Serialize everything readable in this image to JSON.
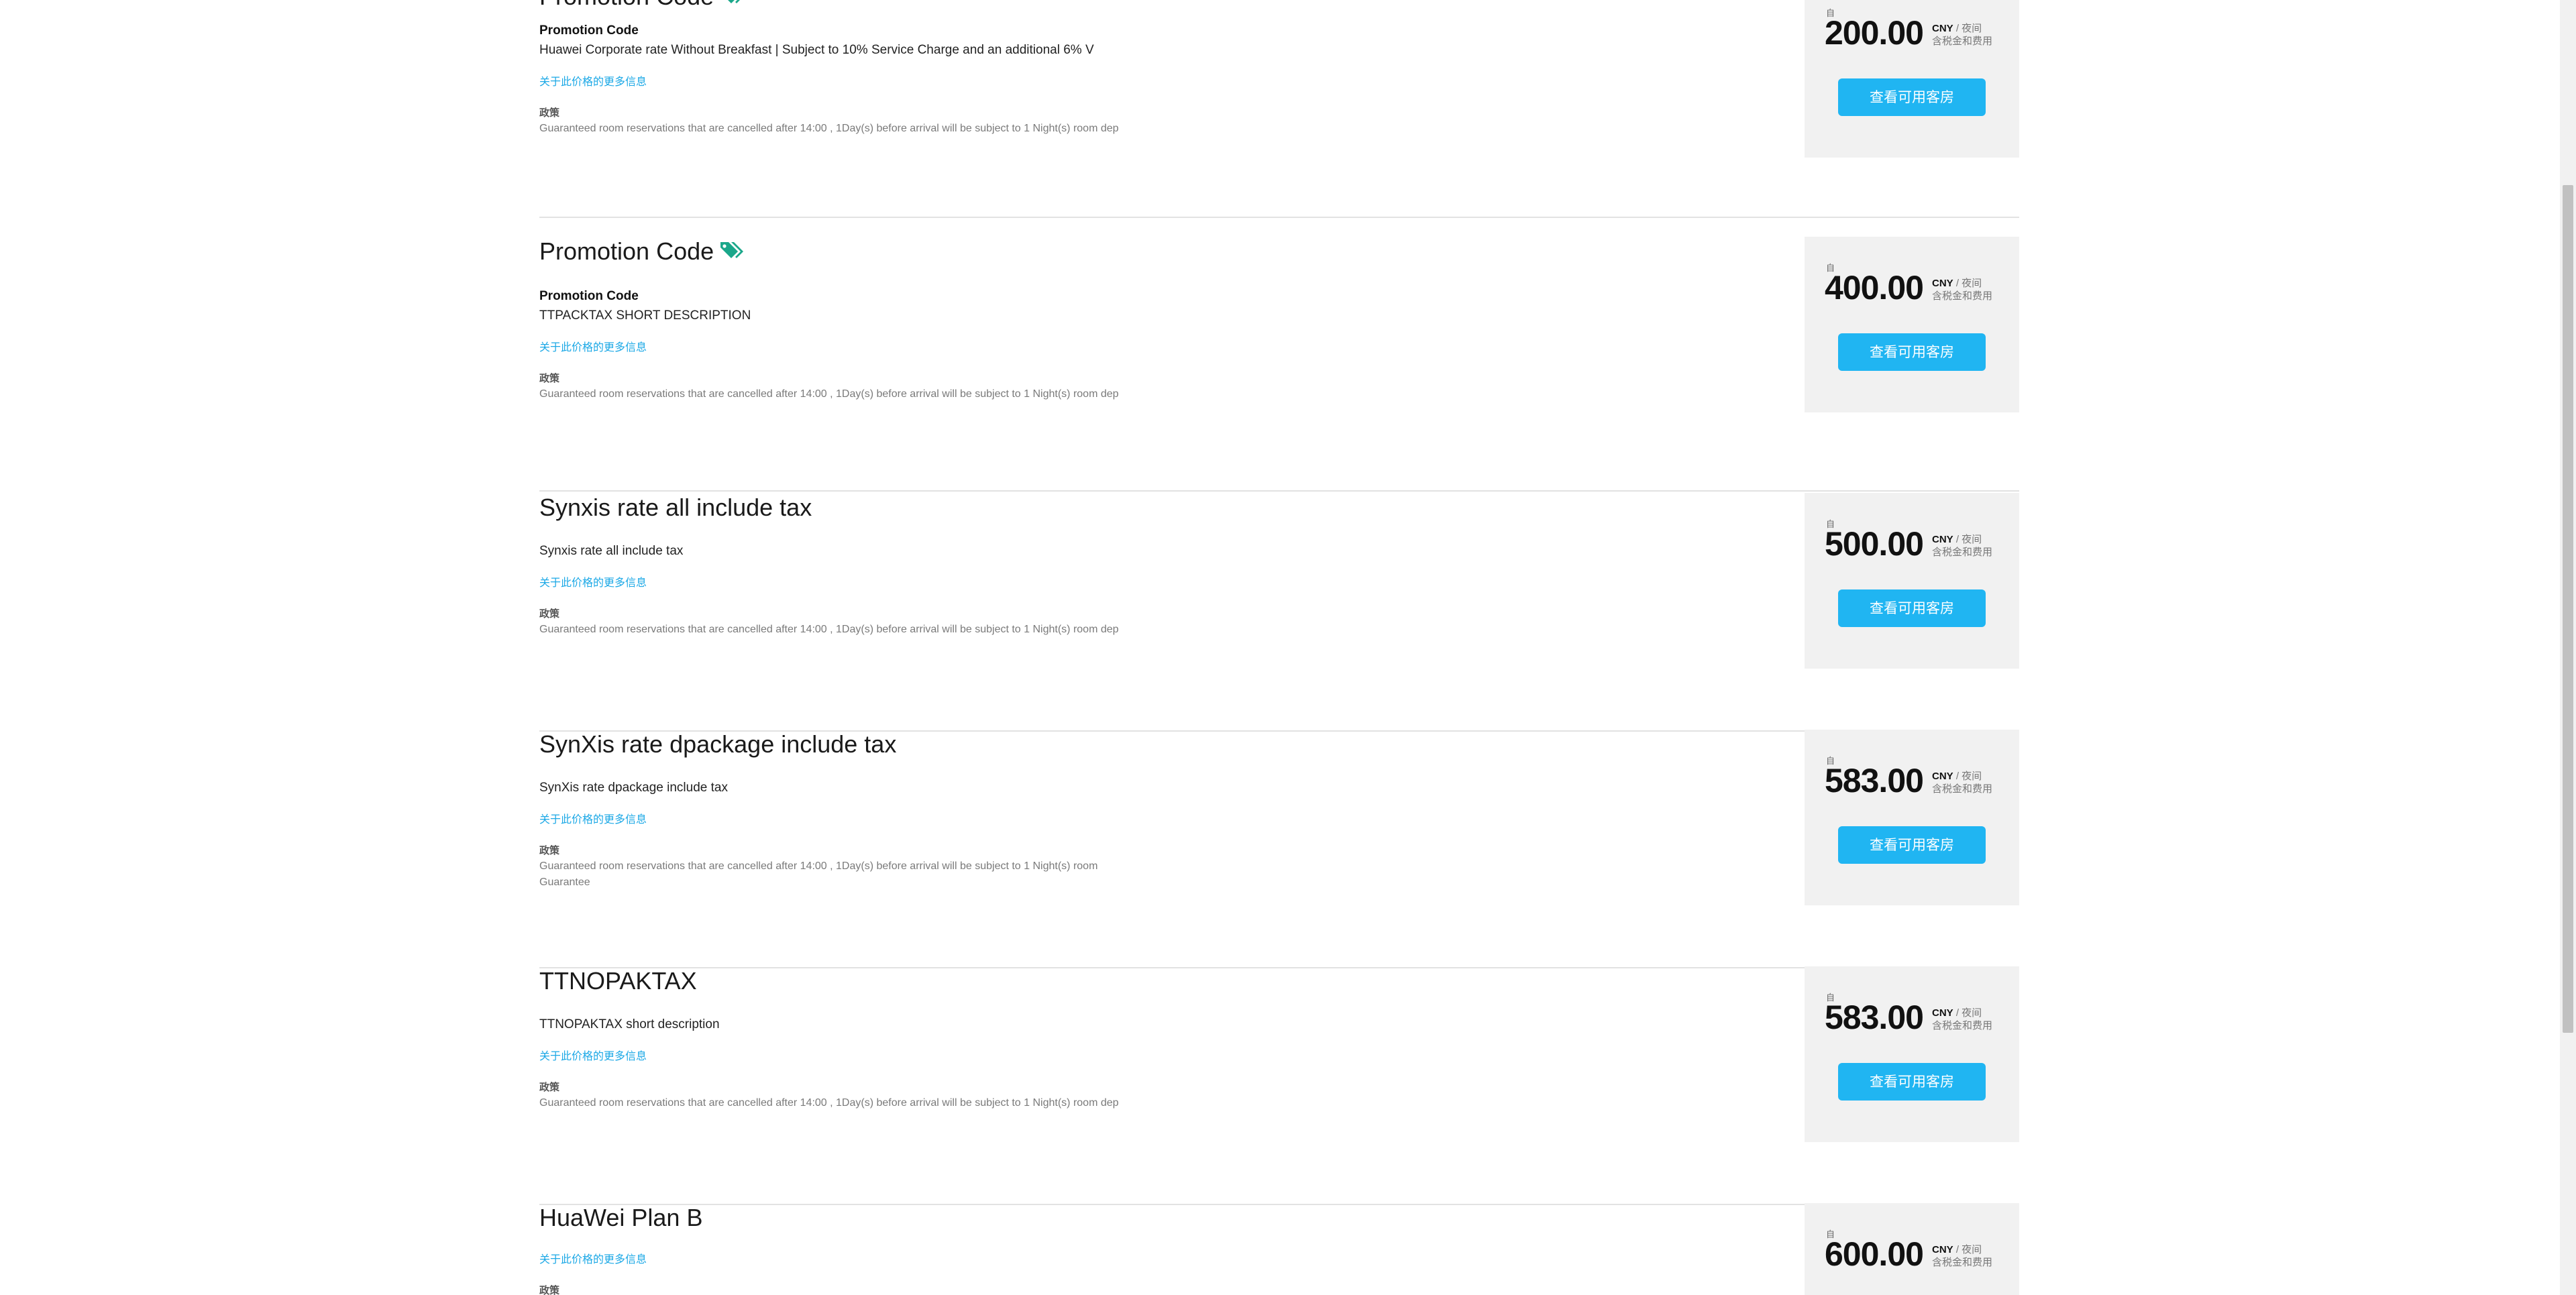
{
  "common": {
    "more_info": "关于此价格的更多信息",
    "policy_label": "政策",
    "from_label": "自",
    "currency": "CNY",
    "per_night": " / 夜间",
    "tax_note": "含税金和费用",
    "view_rooms": "查看可用客房"
  },
  "rates": [
    {
      "title": "Promotion Code",
      "promo_label": "Promotion Code",
      "description": "Huawei Corporate rate Without Breakfast | Subject to 10% Service Charge and an additional 6% V",
      "policy": "Guaranteed room reservations that are cancelled after 14:00 , 1Day(s) before arrival will be subject to 1 Night(s) room dep",
      "price": "200.00"
    },
    {
      "title": "Promotion Code",
      "promo_label": "Promotion Code",
      "description": "TTPACKTAX SHORT DESCRIPTION",
      "policy": "Guaranteed room reservations that are cancelled after 14:00 , 1Day(s) before arrival will be subject to 1 Night(s) room dep",
      "price": "400.00"
    },
    {
      "title": "Synxis rate all include tax",
      "description": "Synxis rate all include tax",
      "policy": "Guaranteed room reservations that are cancelled after 14:00 , 1Day(s) before arrival will be subject to 1 Night(s) room dep",
      "price": "500.00"
    },
    {
      "title": "SynXis rate dpackage include tax",
      "description": "SynXis rate dpackage include tax",
      "policy": "Guaranteed room reservations that are cancelled after 14:00 , 1Day(s) before arrival will be subject to 1 Night(s) room Guarantee",
      "price": "583.00"
    },
    {
      "title": "TTNOPAKTAX",
      "description": "TTNOPAKTAX short description",
      "policy": "Guaranteed room reservations that are cancelled after 14:00 , 1Day(s) before arrival will be subject to 1 Night(s) room dep",
      "price": "583.00"
    },
    {
      "title": "HuaWei Plan B",
      "price": "600.00"
    }
  ],
  "colors": {
    "accent": "#20b5f2",
    "link": "#1ba8e6",
    "tag_icon": "#1aa78a",
    "price_box": "#f1f1f1"
  },
  "icons": {
    "promo_tag": "tags-icon"
  }
}
